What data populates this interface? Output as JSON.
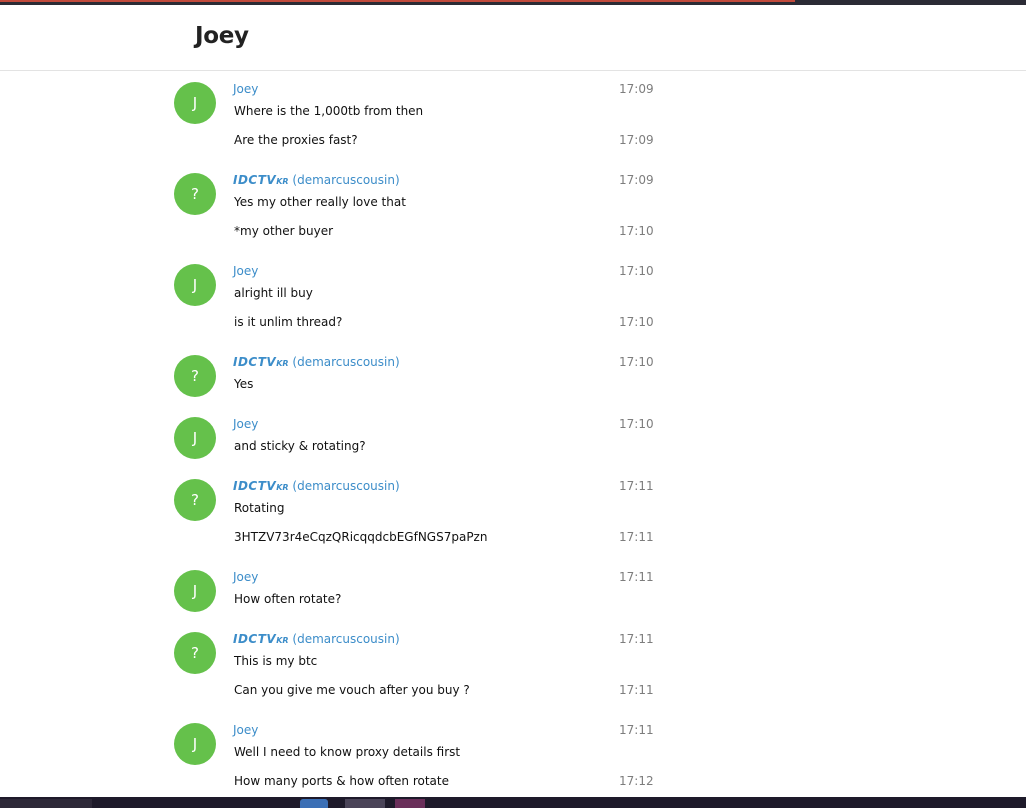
{
  "header": {
    "title": "Joey"
  },
  "colors": {
    "avatar_bg": "#65c14b",
    "sender_name": "#3c8dc9"
  },
  "groups": [
    {
      "avatar": "J",
      "sender": {
        "tag": "",
        "tag_sub": "",
        "name": "Joey"
      },
      "messages": [
        {
          "text": "Where is the 1,000tb from then",
          "time": "17:09"
        },
        {
          "text": "Are the proxies fast?",
          "time": "17:09"
        }
      ]
    },
    {
      "avatar": "?",
      "sender": {
        "tag": "IDCTV",
        "tag_sub": "KR",
        "name": " (demarcuscousin)"
      },
      "messages": [
        {
          "text": "Yes my other really love that",
          "time": "17:09"
        },
        {
          "text": "*my other buyer",
          "time": "17:10"
        }
      ]
    },
    {
      "avatar": "J",
      "sender": {
        "tag": "",
        "tag_sub": "",
        "name": "Joey"
      },
      "messages": [
        {
          "text": "alright ill buy",
          "time": "17:10"
        },
        {
          "text": "is it unlim thread?",
          "time": "17:10"
        }
      ]
    },
    {
      "avatar": "?",
      "sender": {
        "tag": "IDCTV",
        "tag_sub": "KR",
        "name": " (demarcuscousin)"
      },
      "messages": [
        {
          "text": "Yes",
          "time": "17:10"
        }
      ]
    },
    {
      "avatar": "J",
      "sender": {
        "tag": "",
        "tag_sub": "",
        "name": "Joey"
      },
      "messages": [
        {
          "text": "and sticky & rotating?",
          "time": "17:10"
        }
      ]
    },
    {
      "avatar": "?",
      "sender": {
        "tag": "IDCTV",
        "tag_sub": "KR",
        "name": " (demarcuscousin)"
      },
      "messages": [
        {
          "text": "Rotating",
          "time": "17:11"
        },
        {
          "text": "3HTZV73r4eCqzQRicqqdcbEGfNGS7paPzn",
          "time": "17:11"
        }
      ]
    },
    {
      "avatar": "J",
      "sender": {
        "tag": "",
        "tag_sub": "",
        "name": "Joey"
      },
      "messages": [
        {
          "text": "How often rotate?",
          "time": "17:11"
        }
      ]
    },
    {
      "avatar": "?",
      "sender": {
        "tag": "IDCTV",
        "tag_sub": "KR",
        "name": " (demarcuscousin)"
      },
      "messages": [
        {
          "text": "This is my btc",
          "time": "17:11"
        },
        {
          "text": "Can you give me vouch after you buy ?",
          "time": "17:11"
        }
      ]
    },
    {
      "avatar": "J",
      "sender": {
        "tag": "",
        "tag_sub": "",
        "name": "Joey"
      },
      "messages": [
        {
          "text": "Well I need to know proxy details first",
          "time": "17:11"
        },
        {
          "text": "How many ports & how often rotate",
          "time": "17:12"
        }
      ]
    }
  ]
}
